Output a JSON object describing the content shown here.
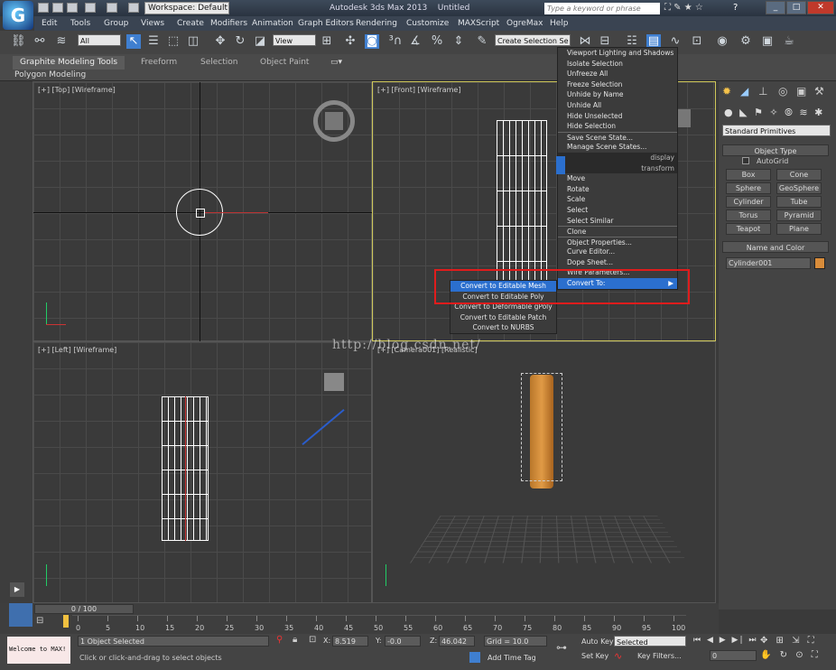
{
  "app": {
    "title": "Autodesk 3ds Max 2013",
    "file": "Untitled",
    "workspace": "Workspace: Default",
    "search_placeholder": "Type a keyword or phrase"
  },
  "menu": [
    "Edit",
    "Tools",
    "Group",
    "Views",
    "Create",
    "Modifiers",
    "Animation",
    "Graph Editors",
    "Rendering",
    "Customize",
    "MAXScript",
    "OgreMax",
    "Help"
  ],
  "toolbar": {
    "filter": "All",
    "refcoord": "View",
    "selection_set": "Create Selection Se"
  },
  "ribbon": {
    "tabs": [
      "Graphite Modeling Tools",
      "Freeform",
      "Selection",
      "Object Paint"
    ],
    "sub": "Polygon Modeling"
  },
  "viewports": {
    "top": "[+] [Top] [Wireframe]",
    "front": "[+] [Front] [Wireframe]",
    "left": "[+] [Left] [Wireframe]",
    "camera": "[+] [Camera001] [Realistic]"
  },
  "context_menu": {
    "items": [
      "Viewport Lighting and Shadows",
      "Isolate Selection",
      "Unfreeze All",
      "Freeze Selection",
      "Unhide by Name",
      "Unhide All",
      "Hide Unselected",
      "Hide Selection",
      "Save Scene State...",
      "Manage Scene States..."
    ],
    "display_label": "display",
    "transform_label": "transform",
    "transform_items": [
      "Move",
      "Rotate",
      "Scale",
      "Select",
      "Select Similar",
      "Clone",
      "Object Properties...",
      "Curve Editor...",
      "Dope Sheet...",
      "Wire Parameters..."
    ],
    "convert_label": "Convert To:"
  },
  "submenu": [
    "Convert to Editable Mesh",
    "Convert to Editable Poly",
    "Convert to Deformable gPoly",
    "Convert to Editable Patch",
    "Convert to NURBS"
  ],
  "cmd_panel": {
    "dropdown": "Standard Primitives",
    "object_type": "Object Type",
    "autogrid": "AutoGrid",
    "buttons": [
      "Box",
      "Cone",
      "Sphere",
      "GeoSphere",
      "Cylinder",
      "Tube",
      "Torus",
      "Pyramid",
      "Teapot",
      "Plane"
    ],
    "name_color": "Name and Color",
    "object_name": "Cylinder001",
    "color": "#d88c3a"
  },
  "timeline": {
    "frame": "0 / 100",
    "ticks": [
      "0",
      "5",
      "10",
      "15",
      "20",
      "25",
      "30",
      "35",
      "40",
      "45",
      "50",
      "55",
      "60",
      "65",
      "70",
      "75",
      "80",
      "85",
      "90",
      "95",
      "100"
    ]
  },
  "status": {
    "script": "Welcome to MAX!",
    "selected": "1 Object Selected",
    "prompt": "Click or click-and-drag to select objects",
    "x_label": "X:",
    "x": "8.519",
    "y_label": "Y:",
    "y": "-0.0",
    "z_label": "Z:",
    "z": "46.042",
    "grid": "Grid = 10.0",
    "add_time_tag": "Add Time Tag",
    "auto_key": "Auto Key",
    "auto_key_value": "Selected",
    "set_key": "Set Key",
    "key_filters": "Key Filters...",
    "frame_field": "0"
  },
  "watermark": "http://blog.csdn.net/"
}
